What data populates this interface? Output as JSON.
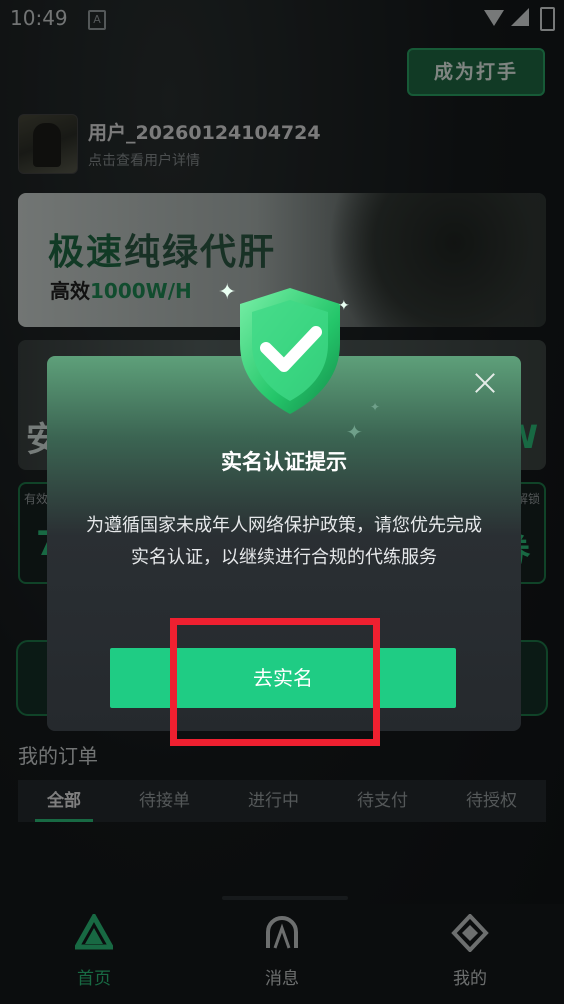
{
  "status_bar": {
    "time": "10:49",
    "notification_icon": "A"
  },
  "header": {
    "become_player_label": "成为打手"
  },
  "user": {
    "name": "用户_20260124104724",
    "detail_link": "点击查看用户详情"
  },
  "banner1": {
    "title_part1": "极速",
    "title_part2": "纯绿代肝",
    "subtitle_part1": "高效",
    "subtitle_part2": "1000W/H"
  },
  "banner2": {
    "left_text": "安",
    "right_text": "W"
  },
  "stats": {
    "left_tag": "有效",
    "right_tag": "解锁",
    "left_value": "7",
    "right_value": "券"
  },
  "orders": {
    "title": "我的订单",
    "tabs": [
      "全部",
      "待接单",
      "进行中",
      "待支付",
      "待授权"
    ]
  },
  "bottom_nav": {
    "items": [
      "首页",
      "消息",
      "我的"
    ]
  },
  "dialog": {
    "title": "实名认证提示",
    "body": "为遵循国家未成年人网络保护政策，请您优先完成实名认证，以继续进行合规的代练服务",
    "confirm_label": "去实名"
  },
  "colors": {
    "accent": "#1fcc84",
    "highlight_box": "#ef2030"
  }
}
